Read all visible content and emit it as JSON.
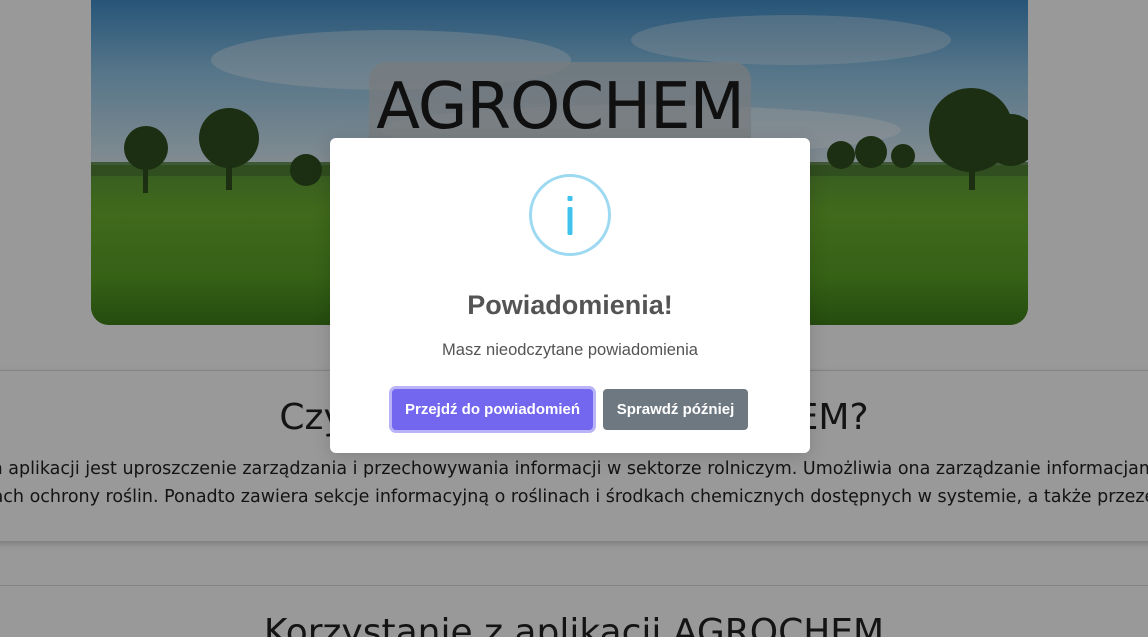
{
  "hero": {
    "title": "AGROCHEM"
  },
  "about": {
    "title": "Czym jest aplikacja AGROCHEM?",
    "line1": "Celem aplikacji jest uproszczenie zarządzania i przechowywania informacji w sektorze rolniczym. Umożliwia ona zarządzanie informacjami o dz",
    "line2": "zabiegach ochrony roślin. Ponadto zawiera sekcje informacyjną o roślinach i środkach chemicznych dostępnych w systemie, a także przezentuje c"
  },
  "usage": {
    "title": "Korzystanie z aplikacji AGROCHEM"
  },
  "modal": {
    "icon": "info-icon",
    "title": "Powiadomienia!",
    "text": "Masz nieodczytane powiadomienia",
    "confirm_label": "Przejdź do powiadomień",
    "cancel_label": "Sprawdź później"
  },
  "colors": {
    "confirm": "#7367f0",
    "cancel": "#6e7881",
    "info": "#3fc3ee"
  }
}
